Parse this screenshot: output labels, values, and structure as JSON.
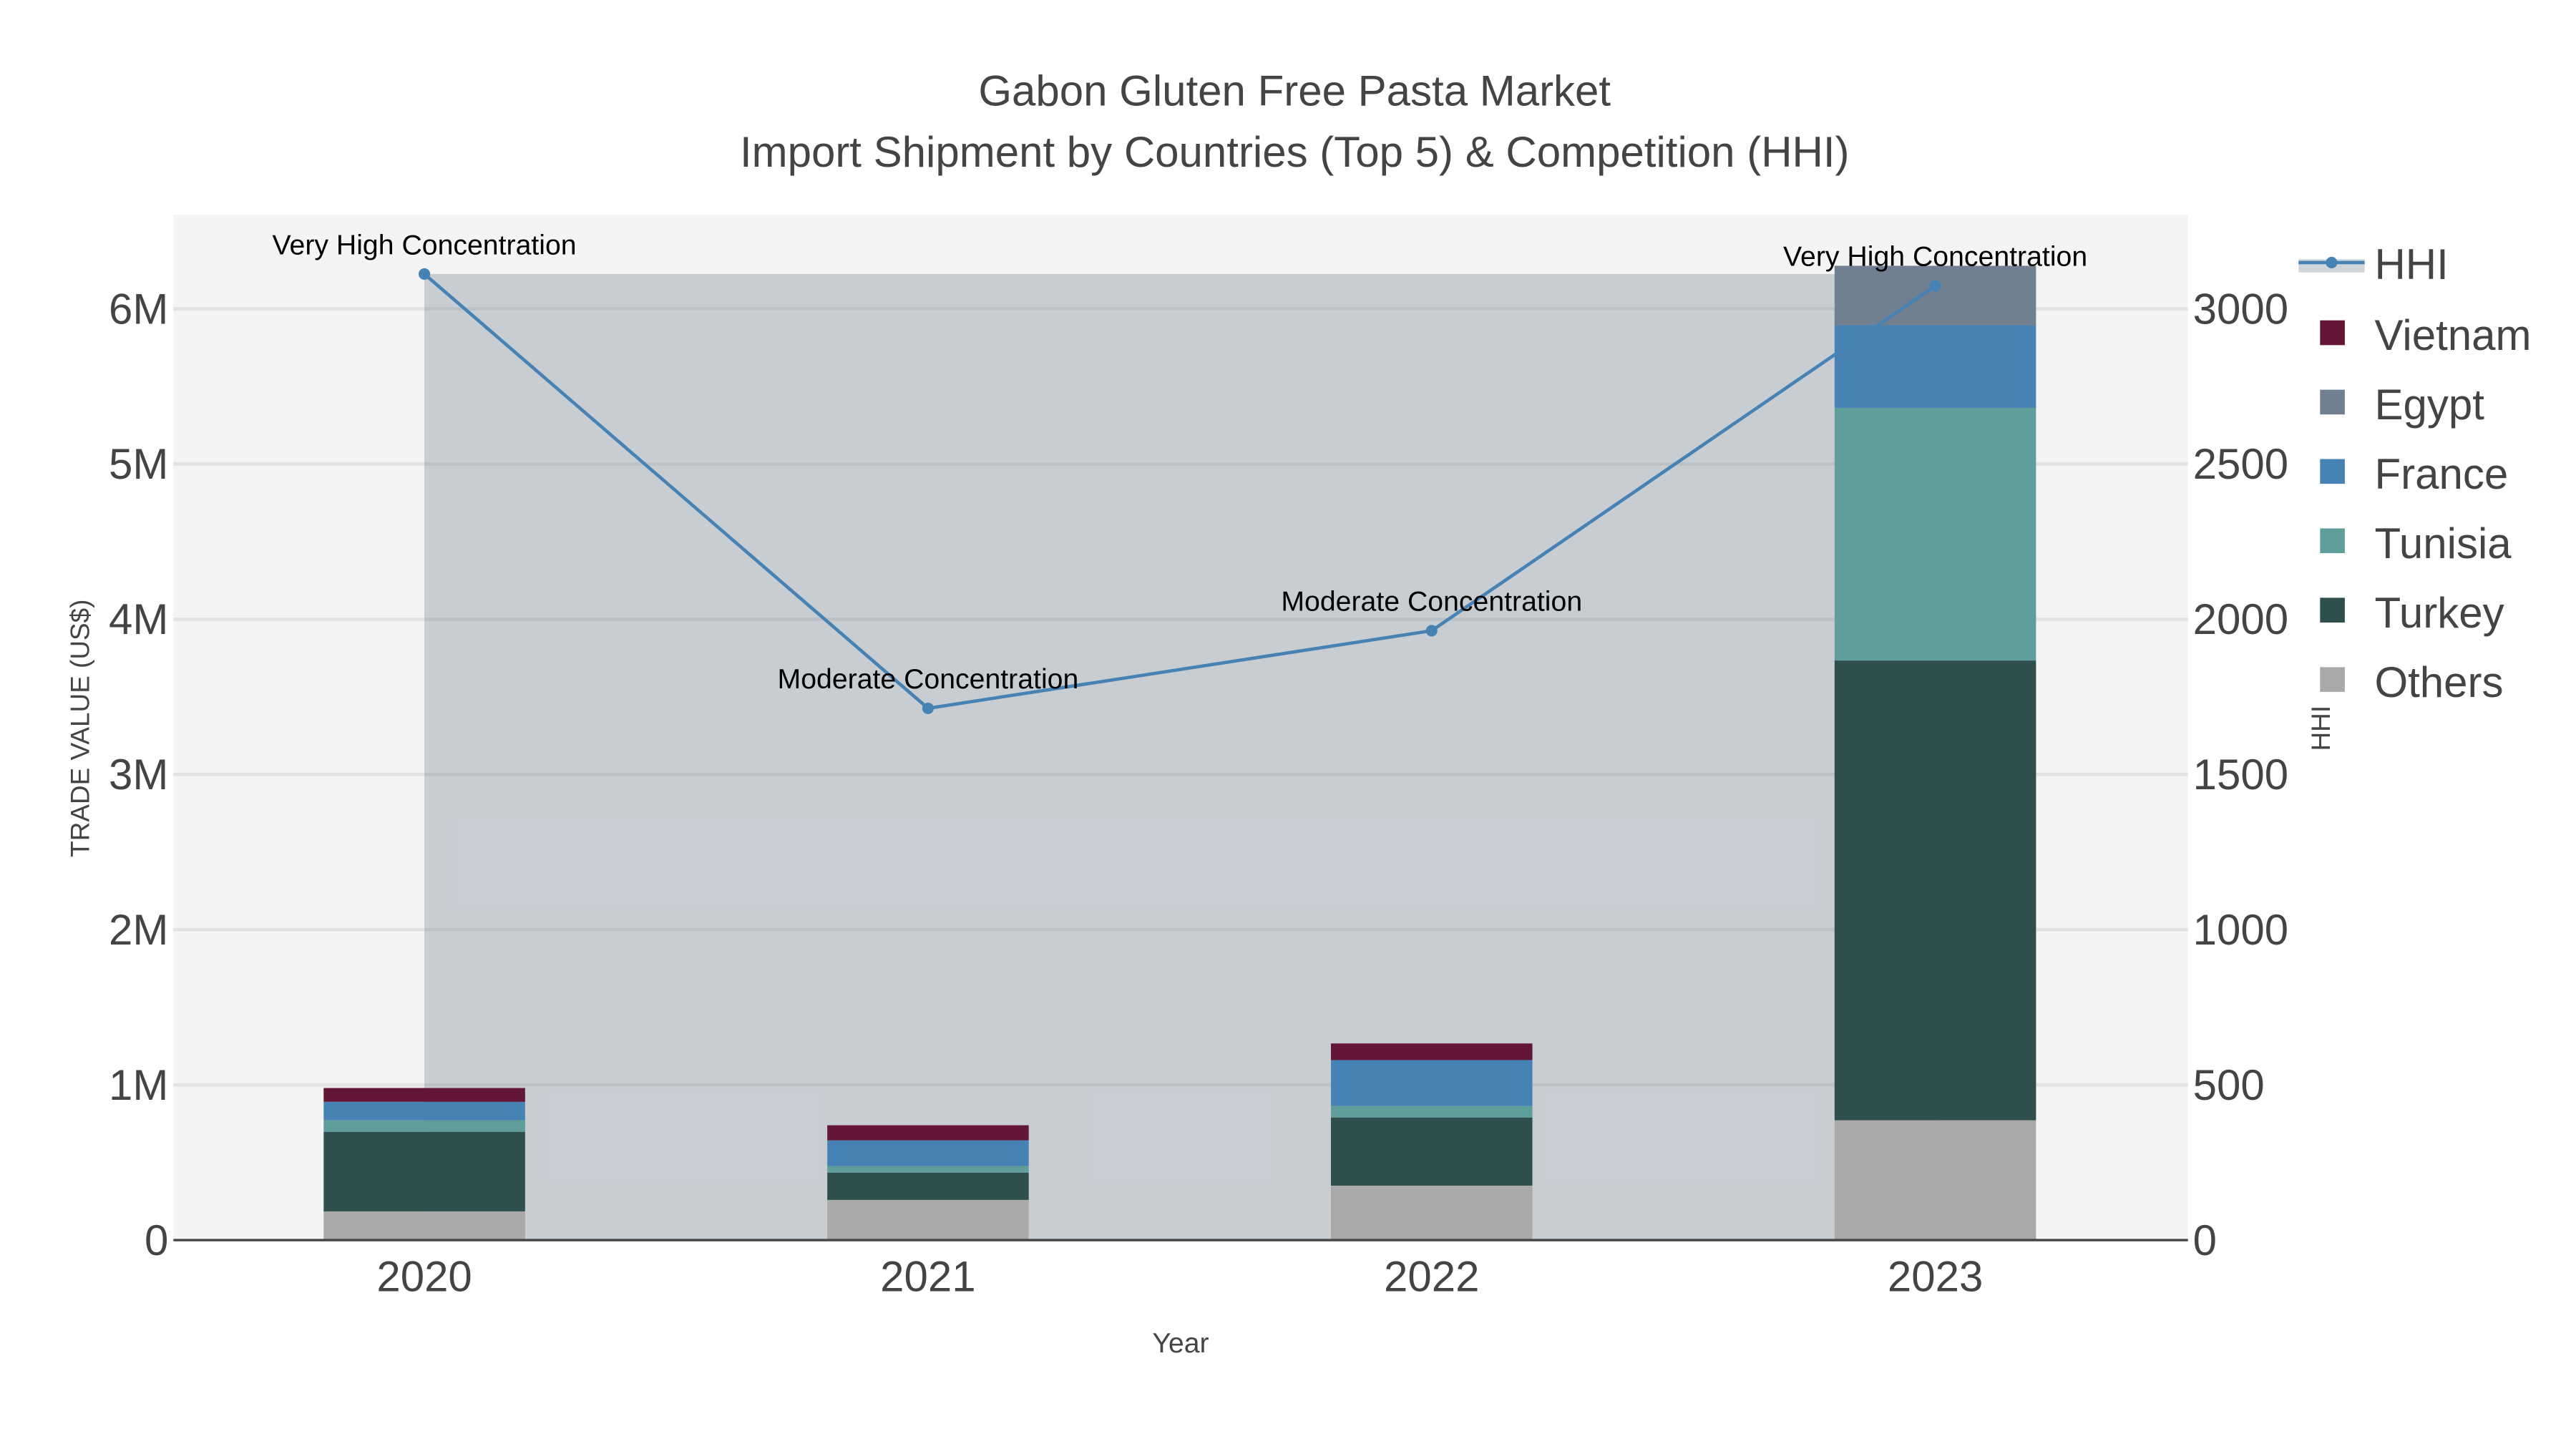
{
  "chart_data": {
    "type": "bar",
    "title": "Gabon Gluten Free Pasta Market",
    "subtitle": "Import Shipment by Countries (Top 5) & Competition (HHI)",
    "xlabel": "Year",
    "ylabel": "TRADE VALUE (US$)",
    "y2label": "HHI",
    "categories": [
      "2020",
      "2021",
      "2022",
      "2023"
    ],
    "ylim": [
      0,
      6500000
    ],
    "y2lim": [
      0,
      3250
    ],
    "yticks": [
      0,
      1000000,
      2000000,
      3000000,
      4000000,
      5000000,
      6000000
    ],
    "ytick_labels": [
      "0",
      "1M",
      "2M",
      "3M",
      "4M",
      "5M",
      "6M"
    ],
    "y2ticks": [
      0,
      500,
      1000,
      1500,
      2000,
      2500,
      3000
    ],
    "y2tick_labels": [
      "0",
      "500",
      "1000",
      "1500",
      "2000",
      "2500",
      "3000"
    ],
    "barmode": "stack",
    "series": [
      {
        "name": "Others",
        "color": "#a9a9a9",
        "values": [
          185000,
          259000,
          351000,
          772000
        ]
      },
      {
        "name": "Turkey",
        "color": "#2f4f4f",
        "values": [
          513000,
          176000,
          439000,
          2962000
        ]
      },
      {
        "name": "Tunisia",
        "color": "#5f9e9a",
        "values": [
          74000,
          42000,
          74000,
          1628000
        ]
      },
      {
        "name": "France",
        "color": "#4682b4",
        "values": [
          119000,
          166000,
          296000,
          532000
        ]
      },
      {
        "name": "Egypt",
        "color": "#708090",
        "values": [
          0,
          0,
          0,
          383000
        ]
      },
      {
        "name": "Vietnam",
        "color": "#641638",
        "values": [
          89000,
          97000,
          107000,
          0
        ]
      }
    ],
    "hhi": {
      "name": "HHI",
      "color": "#4682b4",
      "values": [
        3112,
        1713,
        1963,
        3074
      ]
    },
    "annotations": [
      "Very High Concentration",
      "Moderate Concentration",
      "Moderate Concentration",
      "Very High Concentration"
    ],
    "legend_order": [
      "HHI",
      "Vietnam",
      "Egypt",
      "France",
      "Tunisia",
      "Turkey",
      "Others"
    ],
    "legend_placement": "right",
    "grid": true
  }
}
